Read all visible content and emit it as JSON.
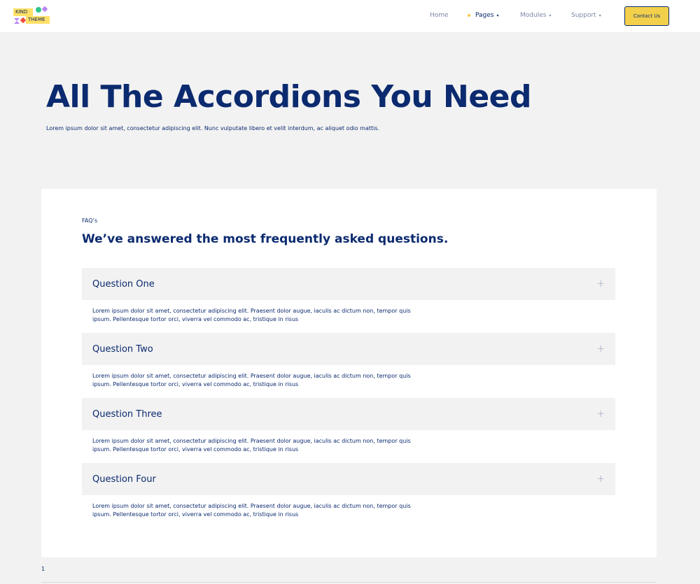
{
  "header": {
    "logo": {
      "line1": "KIND",
      "line2": "THEME"
    },
    "nav": [
      {
        "label": "Home",
        "active": false,
        "dropdown": false
      },
      {
        "label": "Pages",
        "active": true,
        "dropdown": true
      },
      {
        "label": "Modules",
        "active": false,
        "dropdown": true
      },
      {
        "label": "Support",
        "active": false,
        "dropdown": true
      }
    ],
    "contact_label": "Contact Us",
    "caret": "▾"
  },
  "hero": {
    "title": "All The Accordions You Need",
    "subtitle": "Lorem ipsum dolor sit amet, consectetur adipiscing elit. Nunc vulputate libero et velit interdum, ac aliquet odio mattis."
  },
  "faq": {
    "label": "FAQ’s",
    "heading": "We’ve answered the most frequently asked questions.",
    "items": [
      {
        "question": "Question One",
        "answer": "Lorem ipsum dolor sit amet, consectetur adipiscing elit. Praesent dolor augue, iaculis ac dictum non, tempor quis ipsum. Pellentesque tortor orci, viverra vel commodo ac, tristique in risus"
      },
      {
        "question": "Question Two",
        "answer": "Lorem ipsum dolor sit amet, consectetur adipiscing elit. Praesent dolor augue, iaculis ac dictum non, tempor quis ipsum. Pellentesque tortor orci, viverra vel commodo ac, tristique in risus"
      },
      {
        "question": "Question Three",
        "answer": "Lorem ipsum dolor sit amet, consectetur adipiscing elit. Praesent dolor augue, iaculis ac dictum non, tempor quis ipsum. Pellentesque tortor orci, viverra vel commodo ac, tristique in risus"
      },
      {
        "question": "Question Four",
        "answer": "Lorem ipsum dolor sit amet, consectetur adipiscing elit. Praesent dolor augue, iaculis ac dictum non, tempor quis ipsum. Pellentesque tortor orci, viverra vel commodo ac, tristique in risus"
      }
    ],
    "toggle_symbol": "+"
  },
  "pagination": {
    "current": "1"
  },
  "colors": {
    "primary": "#0b2a6f",
    "accent": "#f2d04c",
    "background": "#f2f2f2",
    "card": "#ffffff"
  }
}
